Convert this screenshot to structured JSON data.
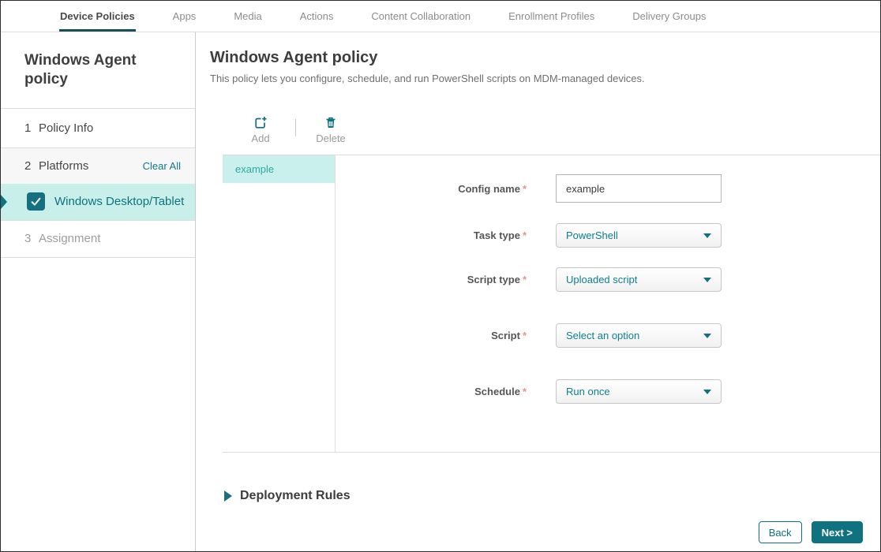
{
  "nav": {
    "tabs": [
      {
        "label": "Device Policies",
        "active": true
      },
      {
        "label": "Apps",
        "active": false
      },
      {
        "label": "Media",
        "active": false
      },
      {
        "label": "Actions",
        "active": false
      },
      {
        "label": "Content Collaboration",
        "active": false
      },
      {
        "label": "Enrollment Profiles",
        "active": false
      },
      {
        "label": "Delivery Groups",
        "active": false
      }
    ]
  },
  "sidebar": {
    "title": "Windows Agent policy",
    "steps": [
      {
        "number": "1",
        "label": "Policy Info"
      },
      {
        "number": "2",
        "label": "Platforms",
        "action": "Clear All"
      },
      {
        "number": "3",
        "label": "Assignment"
      }
    ],
    "platform": {
      "label": "Windows Desktop/Tablet",
      "checked": true
    }
  },
  "main": {
    "title": "Windows Agent policy",
    "description": "This policy lets you configure, schedule, and run PowerShell scripts on MDM-managed devices.",
    "toolbar": {
      "add_label": "Add",
      "delete_label": "Delete"
    },
    "config_list": [
      {
        "name": "example",
        "selected": true
      }
    ],
    "form": {
      "required_marker": "*",
      "fields": [
        {
          "label": "Config name",
          "required": true,
          "type": "text",
          "value": "example"
        },
        {
          "label": "Task type",
          "required": true,
          "type": "select",
          "value": "PowerShell"
        },
        {
          "label": "Script type",
          "required": true,
          "type": "select",
          "value": "Uploaded script"
        },
        {
          "label": "Script",
          "required": true,
          "type": "select",
          "value": "Select an option"
        },
        {
          "label": "Schedule",
          "required": true,
          "type": "select",
          "value": "Run once"
        }
      ]
    },
    "deployment_rules_label": "Deployment Rules",
    "footer": {
      "back_label": "Back",
      "next_label": "Next >"
    }
  },
  "colors": {
    "accent_teal": "#0f7280",
    "link_teal": "#0d7f91",
    "selection_bg": "#c9efeb",
    "list_item_text": "#2fa99e",
    "nav_underline": "#17505b",
    "required_red": "#ec8f8f"
  }
}
